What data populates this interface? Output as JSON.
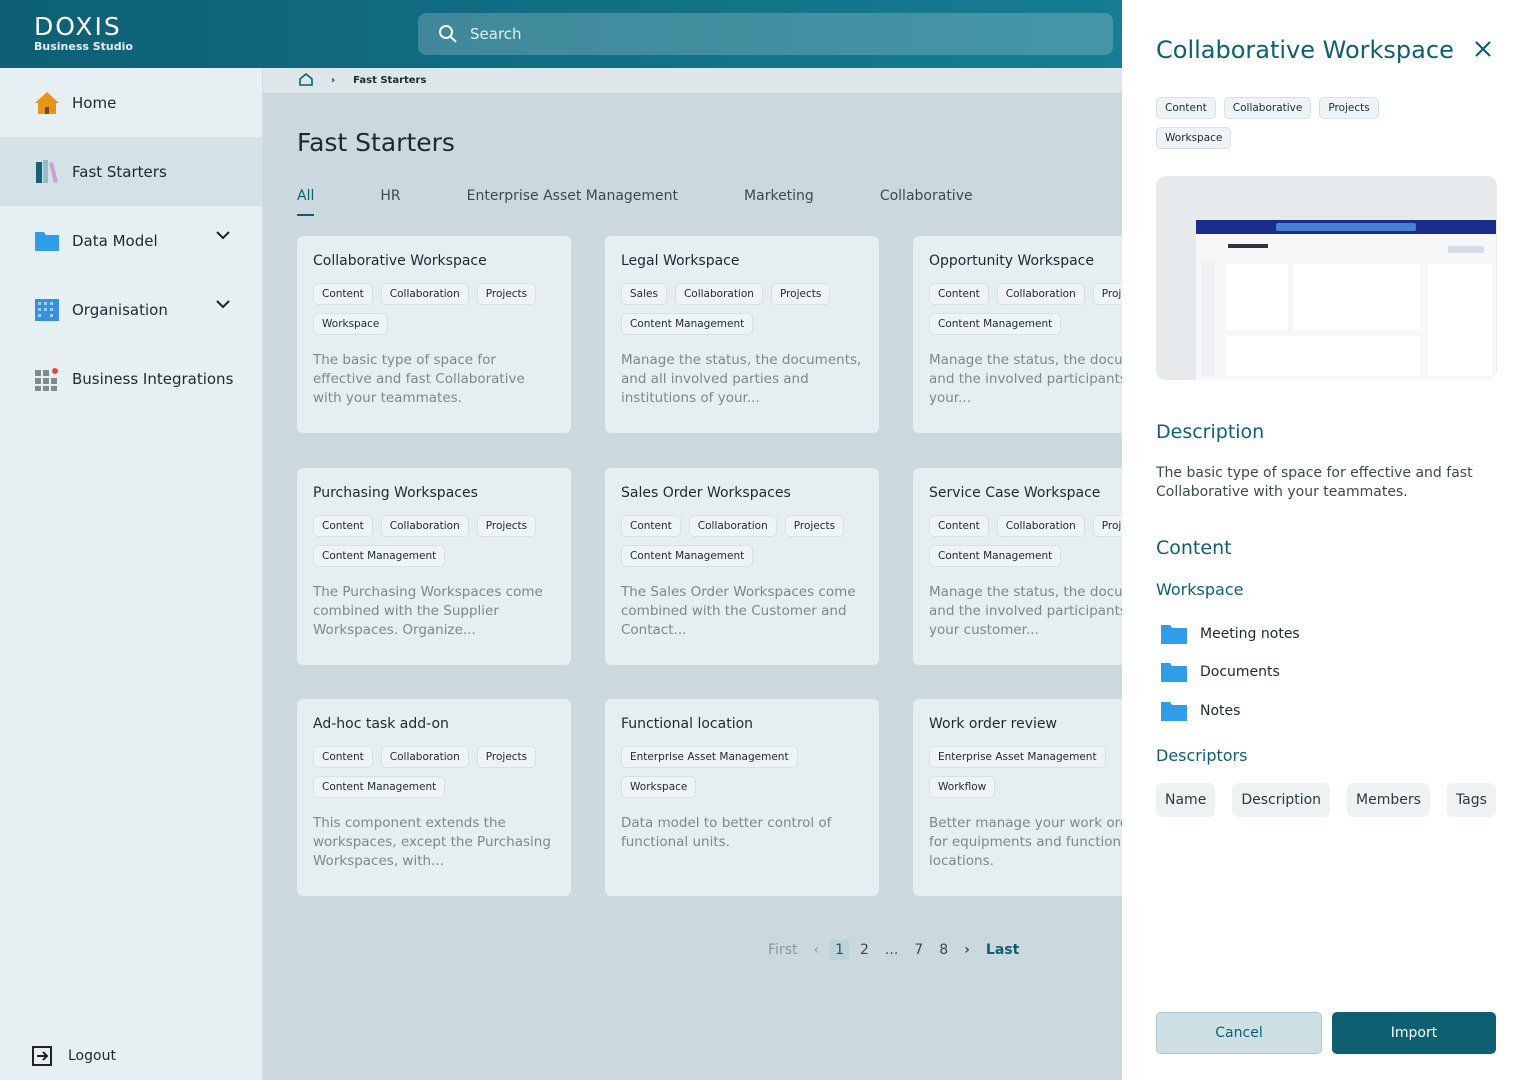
{
  "app": {
    "logo": "DOXIS",
    "subtitle": "Business Studio",
    "search_placeholder": "Search"
  },
  "sidebar": {
    "items": [
      {
        "label": "Home",
        "icon": "home-icon"
      },
      {
        "label": "Fast Starters",
        "icon": "books-icon",
        "active": true
      },
      {
        "label": "Data Model",
        "icon": "folder-icon"
      },
      {
        "label": "Organisation",
        "icon": "building-icon"
      },
      {
        "label": "Business Integrations",
        "icon": "grid-icon"
      }
    ],
    "logout": "Logout"
  },
  "breadcrumb": {
    "current": "Fast Starters"
  },
  "main": {
    "title": "Fast Starters",
    "tabs": [
      "All",
      "HR",
      "Enterprise Asset Management",
      "Marketing",
      "Collaborative"
    ],
    "cards": [
      {
        "title": "Collaborative Workspace",
        "tags": [
          "Content",
          "Collaboration",
          "Projects",
          "Workspace"
        ],
        "desc": "The basic type of space for effective and fast Collaborative with your teammates."
      },
      {
        "title": "Legal Workspace",
        "tags": [
          "Sales",
          "Collaboration",
          "Projects",
          "Content Management"
        ],
        "desc": "Manage the status, the documents, and all involved parties and institutions of your..."
      },
      {
        "title": "Opportunity Workspace",
        "tags": [
          "Content",
          "Collaboration",
          "Projects",
          "Content Management"
        ],
        "desc": "Manage the status, the documents, and the involved participants of your..."
      },
      {
        "title": "Purchasing Workspaces",
        "tags": [
          "Content",
          "Collaboration",
          "Projects",
          "Content Management"
        ],
        "desc": "The Purchasing Workspaces come combined with the Supplier Workspaces. Organize..."
      },
      {
        "title": "Sales Order Workspaces",
        "tags": [
          "Content",
          "Collaboration",
          "Projects",
          "Content Management"
        ],
        "desc": "The Sales Order Workspaces come combined with the Customer and Contact..."
      },
      {
        "title": "Service Case Workspace",
        "tags": [
          "Content",
          "Collaboration",
          "Projects",
          "Content Management"
        ],
        "desc": "Manage the status, the documents, and the involved participants of your customer..."
      },
      {
        "title": "Ad-hoc task add-on",
        "tags": [
          "Content",
          "Collaboration",
          "Projects",
          "Content Management"
        ],
        "desc": "This component extends the workspaces, except the Purchasing Workspaces, with..."
      },
      {
        "title": "Functional location",
        "tags": [
          "Enterprise Asset Management",
          "Workspace"
        ],
        "desc": "Data model to better control of functional units."
      },
      {
        "title": "Work order review",
        "tags": [
          "Enterprise Asset Management",
          "Workflow"
        ],
        "desc": "Better manage your work orders for equipments and functional locations."
      }
    ],
    "pagination": {
      "first": "First",
      "pages": [
        "1",
        "2",
        "...",
        "7",
        "8"
      ],
      "current": "1",
      "last": "Last"
    }
  },
  "drawer": {
    "title": "Collaborative Workspace",
    "tags": [
      "Content",
      "Collaborative",
      "Projects",
      "Workspace"
    ],
    "description_heading": "Description",
    "description": "The basic type of space for effective and fast Collaborative with your teammates.",
    "content_heading": "Content",
    "workspace_heading": "Workspace",
    "folders": [
      "Meeting notes",
      "Documents",
      "Notes"
    ],
    "descriptors_heading": "Descriptors",
    "descriptors": [
      "Name",
      "Description",
      "Members",
      "Tags"
    ],
    "cancel": "Cancel",
    "import": "Import"
  },
  "colors": {
    "primary": "#0e5f72",
    "header": "#0d6076"
  }
}
